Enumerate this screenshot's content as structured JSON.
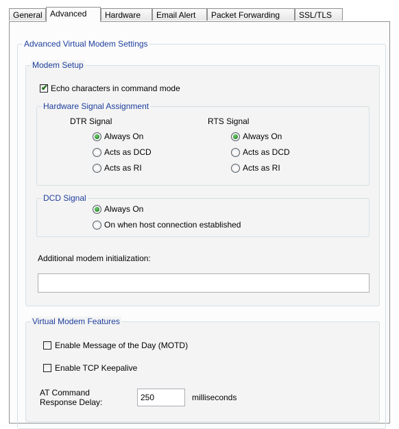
{
  "tabs": [
    {
      "label": "General"
    },
    {
      "label": "Advanced",
      "active": true
    },
    {
      "label": "Hardware"
    },
    {
      "label": "Email Alert"
    },
    {
      "label": "Packet Forwarding"
    },
    {
      "label": "SSL/TLS"
    }
  ],
  "advanced_group": {
    "title": "Advanced Virtual Modem Settings"
  },
  "modem_setup": {
    "title": "Modem Setup",
    "echo_label": "Echo characters in command mode",
    "echo_checked": true,
    "hw_signal": {
      "title": "Hardware Signal Assignment",
      "dtr": {
        "title": "DTR Signal",
        "options": [
          "Always On",
          "Acts as DCD",
          "Acts as RI"
        ],
        "selected": "Always On"
      },
      "rts": {
        "title": "RTS Signal",
        "options": [
          "Always On",
          "Acts as DCD",
          "Acts as RI"
        ],
        "selected": "Always On"
      }
    },
    "dcd": {
      "title": "DCD Signal",
      "options": [
        "Always On",
        "On when host connection established"
      ],
      "selected": "Always On"
    },
    "init_label": "Additional modem initialization:",
    "init_value": ""
  },
  "features": {
    "title": "Virtual Modem Features",
    "motd_label": "Enable Message of the Day (MOTD)",
    "motd_checked": false,
    "keepalive_label": "Enable TCP Keepalive",
    "keepalive_checked": false,
    "delay_label_line1": "AT Command",
    "delay_label_line2": "Response Delay:",
    "delay_value": "250",
    "delay_unit": "milliseconds"
  },
  "colors": {
    "group_title": "#1c3d9c",
    "radio_dot": "#1b8a1b",
    "check_mark": "#1d6b1d"
  }
}
